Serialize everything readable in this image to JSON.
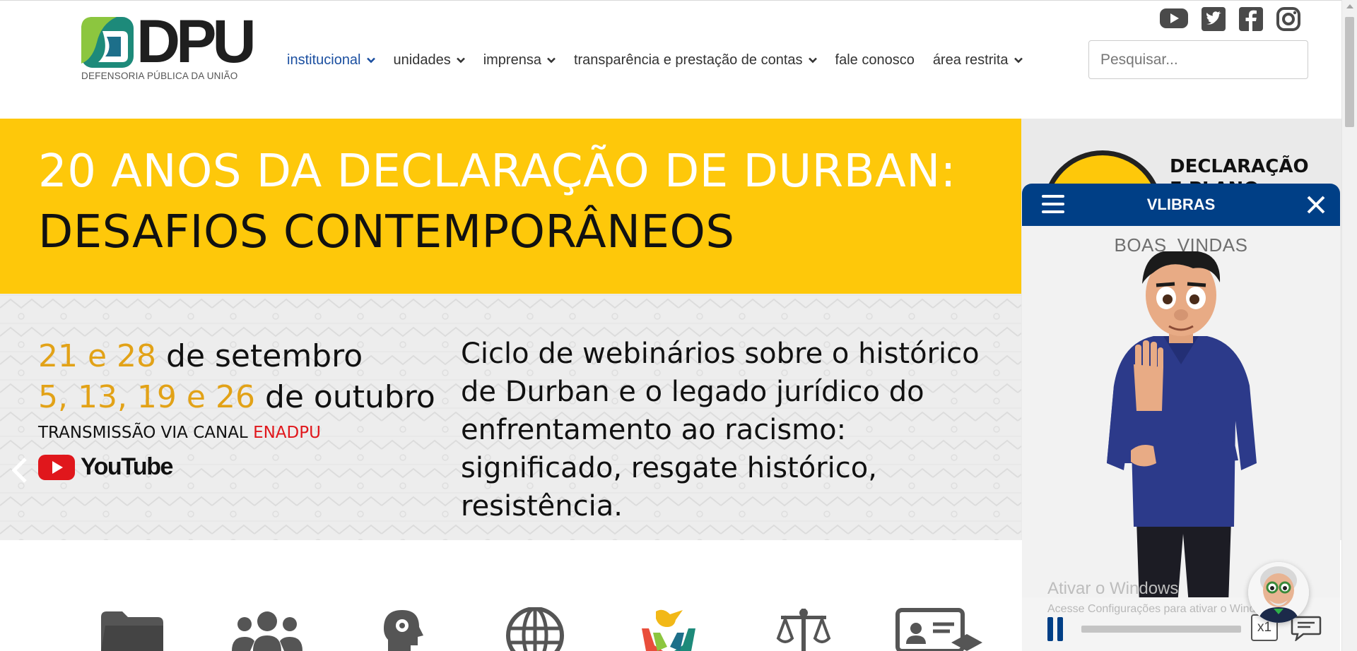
{
  "logo": {
    "name": "DPU",
    "subtitle": "DEFENSORIA PÚBLICA DA UNIÃO"
  },
  "nav": [
    {
      "label": "institucional",
      "dropdown": true,
      "active": true
    },
    {
      "label": "unidades",
      "dropdown": true
    },
    {
      "label": "imprensa",
      "dropdown": true
    },
    {
      "label": "transparência e prestação de contas",
      "dropdown": true
    },
    {
      "label": "fale conosco",
      "dropdown": false
    },
    {
      "label": "área restrita",
      "dropdown": true
    }
  ],
  "social": [
    "youtube-icon",
    "twitter-icon",
    "facebook-icon",
    "instagram-icon"
  ],
  "search": {
    "placeholder": "Pesquisar..."
  },
  "banner": {
    "title_line1": "20 ANOS DA DECLARAÇÃO DE DURBAN:",
    "title_line2": "DESAFIOS CONTEMPORÂNEOS",
    "dates_line1": {
      "highlight": "21 e 28",
      "rest": " de setembro"
    },
    "dates_line2": {
      "highlight": "5, 13, 19 e 26",
      "rest": " de outubro"
    },
    "transmission": {
      "prefix": "TRANSMISSÃO VIA CANAL ",
      "channel": "ENADPU"
    },
    "youtube_word": "YouTube",
    "description": "Ciclo de webinários sobre o histórico de Durban e o legado jurídico do enfrentamento ao racismo: significado, resgate histórico, resistência."
  },
  "banner_next": {
    "text_line1": "DECLARAÇÃO",
    "text_line2": "E PLANO"
  },
  "vlibras": {
    "title": "VLIBRAS",
    "gloss": "BOAS_VINDAS",
    "speed": "x1"
  },
  "windows_watermark": {
    "line1": "Ativar o Windows",
    "line2": "Acesse Configurações para ativar o Windows."
  },
  "colors": {
    "brand_blue": "#1b4fa0",
    "banner_yellow": "#fec80a",
    "date_gold": "#e2a217",
    "vlibras_blue": "#003f86"
  }
}
